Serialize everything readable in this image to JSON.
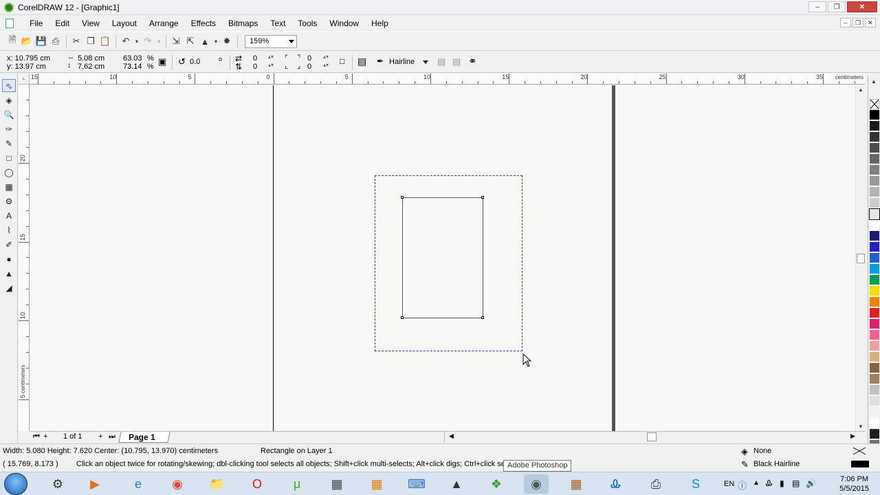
{
  "window": {
    "title": "CorelDRAW 12 - [Graphic1]"
  },
  "menu": {
    "items": [
      "File",
      "Edit",
      "View",
      "Layout",
      "Arrange",
      "Effects",
      "Bitmaps",
      "Text",
      "Tools",
      "Window",
      "Help"
    ]
  },
  "toolbar": {
    "zoom": "159%"
  },
  "propbar": {
    "x": "x: 10.795 cm",
    "y": "y: 13.97 cm",
    "width": "5.08 cm",
    "height": "7.62 cm",
    "scale_x": "63.03",
    "scale_y": "73.14",
    "pct": "%",
    "rotation": "0.0",
    "deg": "o",
    "corner_tl": "0",
    "corner_bl": "0",
    "corner_tr": "0",
    "corner_br": "0",
    "outline": "Hairline"
  },
  "rulers": {
    "unit": "centimeters",
    "h_labels": [
      "15",
      "10",
      "5",
      "0",
      "5",
      "10",
      "15",
      "20",
      "25",
      "30",
      "35"
    ],
    "v_labels": [
      "20",
      "15",
      "10",
      "5"
    ]
  },
  "pages": {
    "count_label": "1 of 1",
    "tab_label": "Page 1"
  },
  "status": {
    "dimensions": "Width: 5.080  Height: 7.620  Center: (10.795, 13.970)  centimeters",
    "object_info": "Rectangle on Layer 1",
    "cursor_pos": "( 15.769, 8.173 )",
    "hint": "Click an object twice for rotating/skewing; dbl-clicking tool selects all objects; Shift+click multi-selects; Alt+click digs; Ctrl+click selects in a",
    "fill": "None",
    "outline": "Black  Hairline",
    "tooltip": "Adobe Photoshop"
  },
  "taskbar": {
    "language": "EN",
    "time": "7:06 PM",
    "date": "5/5/2015"
  },
  "colors": {
    "palette": [
      "#ffffff",
      "#000000",
      "#1a1a1a",
      "#333333",
      "#4d4d4d",
      "#666666",
      "#808080",
      "#999999",
      "#b3b3b3",
      "#cccccc",
      "#e6e6e6",
      "#ffffff",
      "#1c1c6e",
      "#2020c8",
      "#1f5fd6",
      "#00a0e0",
      "#00a050",
      "#f0e000",
      "#f08000",
      "#e02020",
      "#e0206a",
      "#f06090",
      "#f0a0a0",
      "#d8b080",
      "#8a6040",
      "#a08060",
      "#c0c0c0",
      "#e0e0e0",
      "#f0f0f0",
      "#ffffff",
      "#202020",
      "#707070"
    ],
    "page_background": "#f6f9f6",
    "selection": "#2a3aa0"
  }
}
